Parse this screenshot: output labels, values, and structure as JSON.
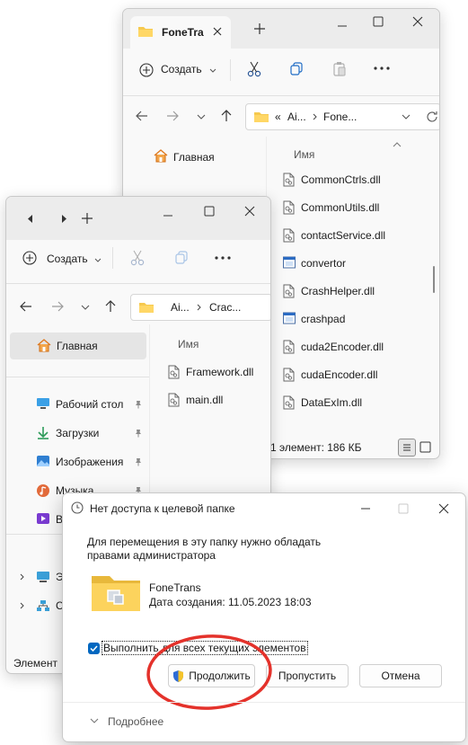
{
  "back_window": {
    "tab_title": "FoneTra",
    "new_label": "Создать",
    "breadcrumb": [
      "«",
      "Ai...",
      "Fone..."
    ],
    "nav_home": "Главная",
    "column_name": "Имя",
    "files": [
      {
        "name": "CommonCtrls.dll",
        "icon": "dll-icon"
      },
      {
        "name": "CommonUtils.dll",
        "icon": "dll-icon"
      },
      {
        "name": "contactService.dll",
        "icon": "dll-icon"
      },
      {
        "name": "convertor",
        "icon": "exe-icon"
      },
      {
        "name": "CrashHelper.dll",
        "icon": "dll-icon"
      },
      {
        "name": "crashpad",
        "icon": "exe-icon"
      },
      {
        "name": "cuda2Encoder.dll",
        "icon": "dll-icon"
      },
      {
        "name": "cudaEncoder.dll",
        "icon": "dll-icon"
      },
      {
        "name": "DataExIm.dll",
        "icon": "dll-icon"
      }
    ],
    "status": "1 элемент: 186 КБ"
  },
  "front_window": {
    "new_label": "Создать",
    "breadcrumb": [
      "Ai...",
      "Crac..."
    ],
    "nav_home": "Главная",
    "column_name": "Имя",
    "files": [
      {
        "name": "Framework.dll",
        "icon": "dll-icon"
      },
      {
        "name": "main.dll",
        "icon": "dll-icon"
      }
    ],
    "quick_access": [
      {
        "label": "Рабочий стол",
        "icon": "desktop-icon"
      },
      {
        "label": "Загрузки",
        "icon": "downloads-icon"
      },
      {
        "label": "Изображения",
        "icon": "pictures-icon"
      },
      {
        "label": "Музыка",
        "icon": "music-icon"
      },
      {
        "label": "В",
        "icon": "videos-icon"
      }
    ],
    "tree": [
      {
        "label": "Э",
        "icon": "this-pc-icon"
      },
      {
        "label": "С",
        "icon": "network-icon"
      }
    ],
    "status": "Элемент"
  },
  "dialog": {
    "title": "Нет доступа к целевой папке",
    "message": "Для перемещения в эту папку нужно обладать правами администратора",
    "folder_name": "FoneTrans",
    "folder_date": "Дата создания: 11.05.2023 18:03",
    "checkbox_label": "Выполнить для всех текущих элементов",
    "checkbox_checked": true,
    "continue_label": "Продолжить",
    "skip_label": "Пропустить",
    "cancel_label": "Отмена",
    "details_label": "Подробнее"
  },
  "colors": {
    "accent": "#0067c0",
    "highlight": "#e5e5e5",
    "annotation_red": "#e4322b",
    "folder_yellow": "#f6c94e"
  }
}
